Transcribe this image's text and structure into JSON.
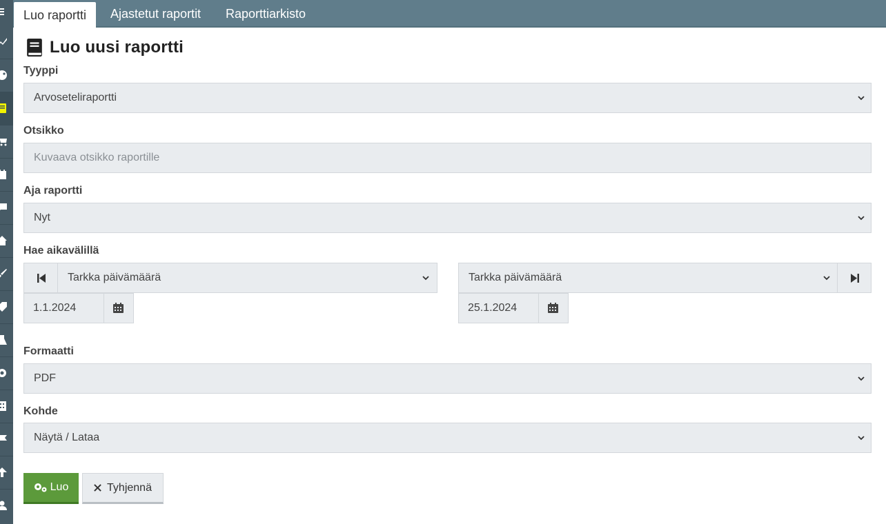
{
  "tabs": [
    {
      "label": "Luo raportti",
      "active": true
    },
    {
      "label": "Ajastetut raportit",
      "active": false
    },
    {
      "label": "Raporttiarkisto",
      "active": false
    }
  ],
  "page": {
    "title": "Luo uusi raportti",
    "title_icon": "book-icon"
  },
  "form": {
    "type": {
      "label": "Tyyppi",
      "value": "Arvoseteliraportti"
    },
    "title": {
      "label": "Otsikko",
      "placeholder": "Kuvaava otsikko raportille"
    },
    "run": {
      "label": "Aja raportti",
      "value": "Nyt"
    },
    "range": {
      "label": "Hae aikavälillä",
      "start_mode": "Tarkka päivämäärä",
      "start_date": "1.1.2024",
      "end_mode": "Tarkka päivämäärä",
      "end_date": "25.1.2024"
    },
    "format": {
      "label": "Formaatti",
      "value": "PDF"
    },
    "target": {
      "label": "Kohde",
      "value": "Näytä / Lataa"
    }
  },
  "buttons": {
    "create": "Luo",
    "clear": "Tyhjennä"
  },
  "colors": {
    "tabbar": "#607d8b",
    "rail": "#475b66",
    "primary": "#5c9a3b",
    "field_bg": "#e9ecef",
    "active_rail_icon": "#f3f300"
  },
  "rail_icons": [
    "menu-icon",
    "chart-icon",
    "palette-icon",
    "book-icon",
    "cart-icon",
    "calendar-icon",
    "chat-icon",
    "home-icon",
    "brush-icon",
    "tag-icon",
    "flask-icon",
    "gear-icon",
    "building-icon",
    "flag-icon",
    "arrow-up-icon",
    "users-icon"
  ]
}
